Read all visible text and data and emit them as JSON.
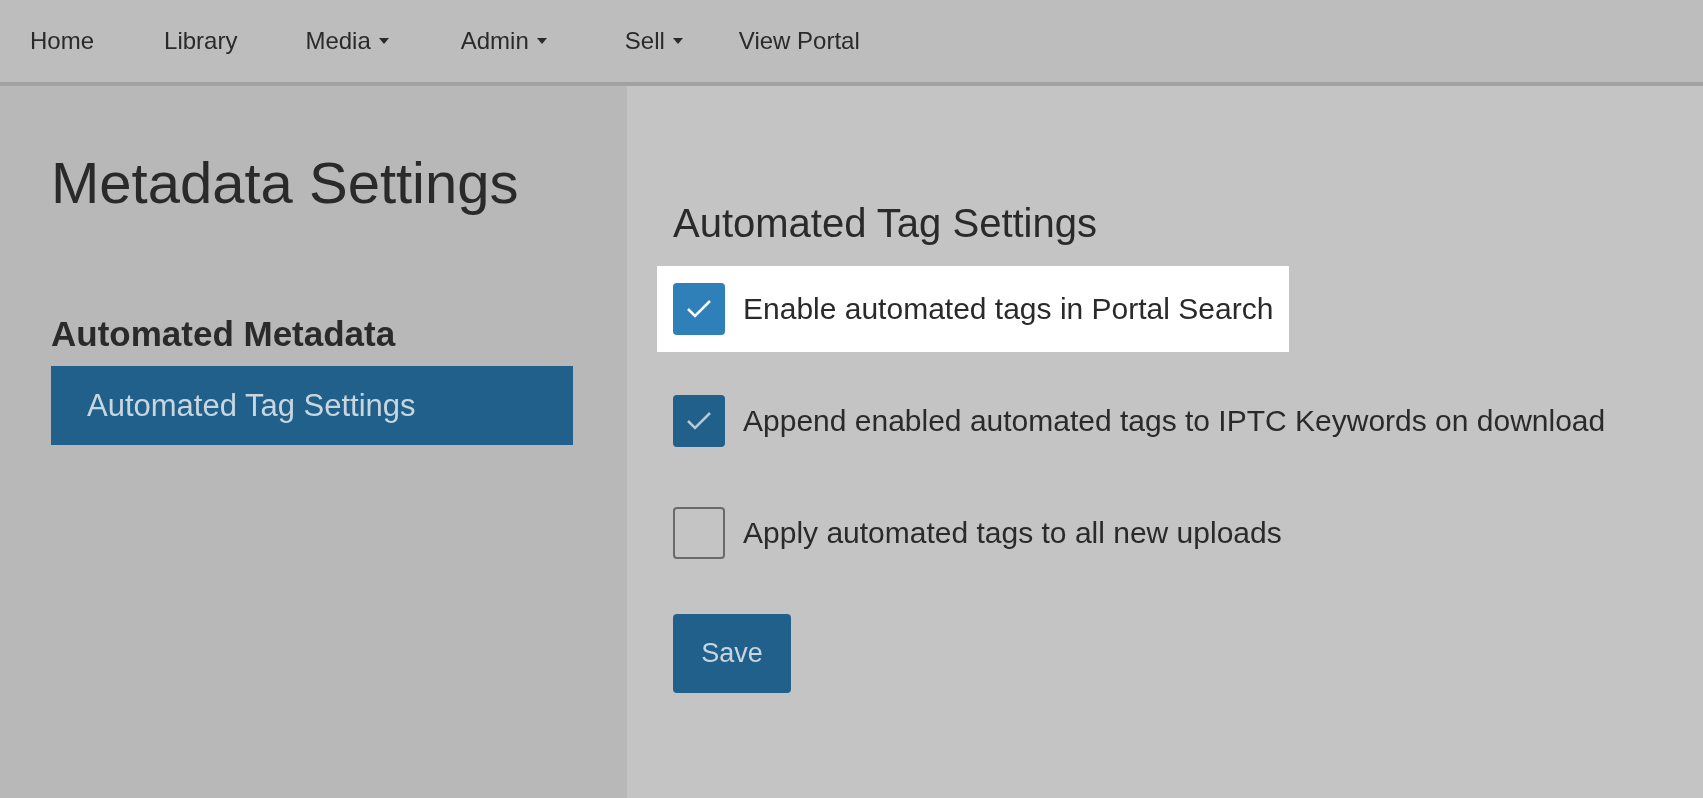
{
  "nav": [
    {
      "label": "Home",
      "dropdown": false
    },
    {
      "label": "Library",
      "dropdown": false
    },
    {
      "label": "Media",
      "dropdown": true
    },
    {
      "label": "Admin",
      "dropdown": true
    },
    {
      "label": "Sell",
      "dropdown": true
    },
    {
      "label": "View Portal",
      "dropdown": false
    }
  ],
  "sidebar": {
    "title": "Metadata Settings",
    "section": "Automated Metadata",
    "items": [
      {
        "label": "Automated Tag Settings",
        "selected": true
      }
    ]
  },
  "main": {
    "heading": "Automated Tag Settings",
    "options": [
      {
        "label": "Enable automated tags in Portal Search",
        "checked": true,
        "highlighted": true
      },
      {
        "label": "Append enabled automated tags to IPTC Keywords on download",
        "checked": true,
        "highlighted": false
      },
      {
        "label": "Apply automated tags to all new uploads",
        "checked": false,
        "highlighted": false
      }
    ],
    "save": "Save"
  }
}
